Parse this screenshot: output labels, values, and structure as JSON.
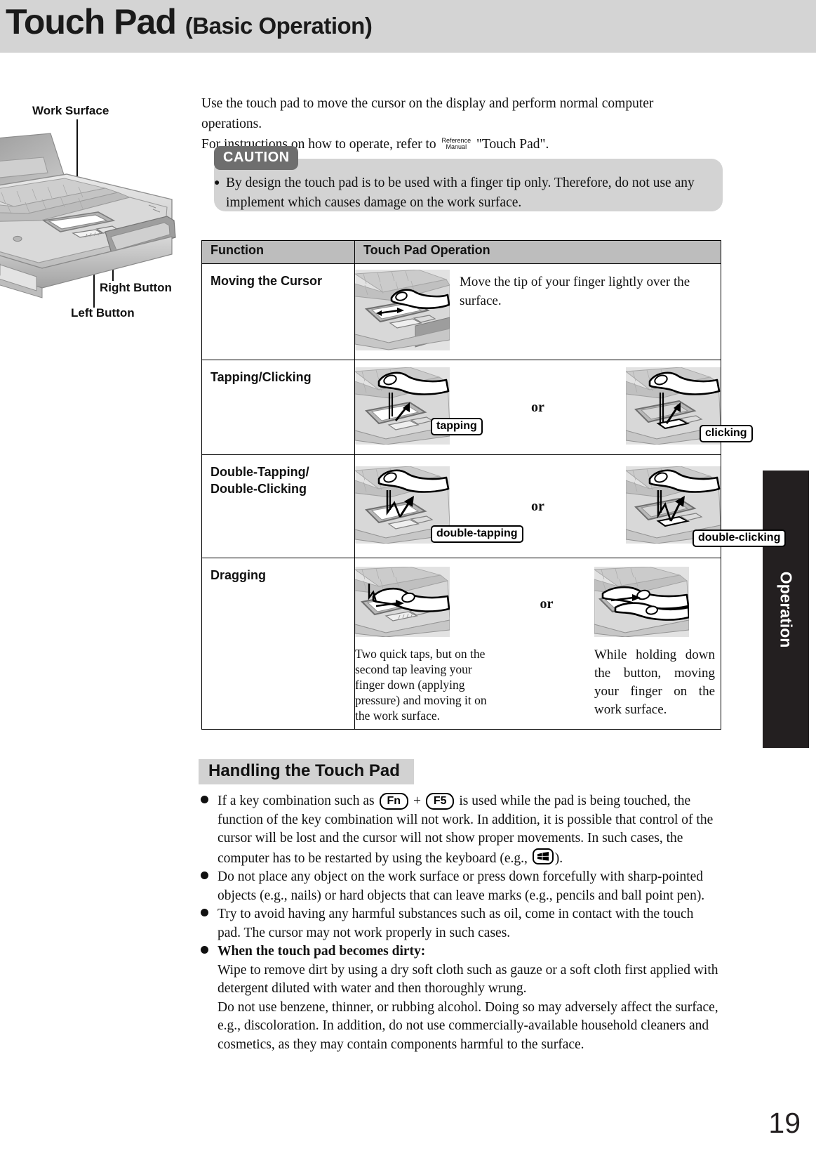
{
  "header": {
    "title_main": "Touch Pad",
    "title_sub": "(Basic Operation)"
  },
  "illustration": {
    "label_work_surface": "Work Surface",
    "label_right_button": "Right Button",
    "label_left_button": "Left Button"
  },
  "intro": {
    "line1": "Use the touch pad to move the cursor on the display and perform normal computer operations.",
    "line2_before": "For instructions on how to operate, refer to",
    "refman_line1": "Reference",
    "refman_line2": "Manual",
    "line2_after": "\"Touch Pad\"."
  },
  "caution": {
    "label": "CAUTION",
    "text": "By design the touch pad is to be used with a finger tip only.  Therefore, do not use any implement which causes damage on the work surface."
  },
  "table": {
    "headers": [
      "Function",
      "Touch Pad Operation"
    ],
    "rows": [
      {
        "function": "Moving the Cursor",
        "description": "Move the tip of your finger lightly over the surface.",
        "callouts": [],
        "or_label": ""
      },
      {
        "function": "Tapping/Clicking",
        "or_label": "or",
        "callout_left": "tapping",
        "callout_right": "clicking"
      },
      {
        "function": "Double-Tapping/ Double-Clicking",
        "function_line1": "Double-Tapping/",
        "function_line2": "Double-Clicking",
        "or_label": "or",
        "callout_left": "double-tapping",
        "callout_right": "double-clicking"
      },
      {
        "function": "Dragging",
        "or_label": "or",
        "caption_left": "Two quick taps, but on the second tap leaving your finger down (applying pressure) and moving it on the work surface.",
        "caption_right": "While holding down the button, moving your finger on the work surface."
      }
    ]
  },
  "side_tab": {
    "label": "Operation"
  },
  "handling": {
    "heading": "Handling the Touch Pad",
    "bullets": [
      {
        "id": "key-combination",
        "part1": "If a key combination such as",
        "key1": "Fn",
        "plus": "+",
        "key2": "F5",
        "part2": "is used while the pad is being touched, the function of the key combination will not work.  In addition, it is possible that control of the cursor will be lost and the cursor will not show proper movements.  In such cases, the computer has to be restarted by using the keyboard (e.g.,",
        "win_key": "windows-key-icon",
        "part3": ")."
      },
      {
        "id": "no-objects",
        "text": "Do not place any object on the work surface or press down forcefully with sharp-pointed objects (e.g., nails) or hard objects that can leave marks (e.g., pencils and ball point pen)."
      },
      {
        "id": "no-harmful-substances",
        "text": "Try to avoid having any harmful substances such as oil, come in contact with the touch pad.  The cursor may not work properly in such cases."
      },
      {
        "id": "when-dirty",
        "bold_lead": "When the touch pad becomes dirty:",
        "para1": "Wipe to remove dirt by using a dry soft cloth such as gauze or a soft cloth first applied with detergent diluted with water and then thoroughly wrung.",
        "para2": "Do not use benzene, thinner, or rubbing alcohol. Doing so may adversely affect the surface, e.g., discoloration.  In addition, do not use commercially-available household cleaners and cosmetics, as they may contain components harmful to the surface."
      }
    ]
  },
  "footer": {
    "page_number": "19"
  },
  "colors": {
    "header_band": "#d4d4d4",
    "caution_bg": "#d3d3d3",
    "caution_tab": "#6e6e6e",
    "table_header": "#bdbdbd",
    "side_tab": "#231f20",
    "heading_highlight": "#d2d2d2"
  }
}
